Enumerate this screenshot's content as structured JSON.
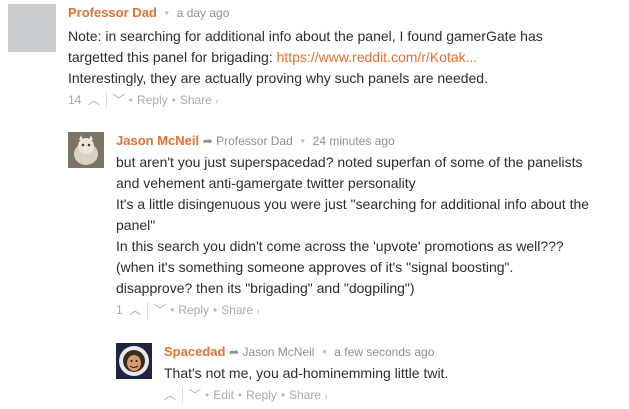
{
  "comments": [
    {
      "author": "Professor Dad",
      "reply_to": "",
      "time": "a day ago",
      "lines": [
        "Note: in searching for additional info about the panel, I found gamerGate has",
        "targetted this panel for brigading: ",
        "Interestingly, they are actually proving why such panels are needed."
      ],
      "link_text": "https://www.reddit.com/r/Kotak...",
      "upvotes": "14",
      "actions": {
        "reply": "Reply",
        "share": "Share"
      }
    },
    {
      "author": "Jason McNeil",
      "reply_to": "Professor Dad",
      "time": "24 minutes ago",
      "lines": [
        "but aren't you just superspacedad? noted superfan of some of the panelists",
        "and vehement anti-gamergate twitter personality",
        "It's a little disingenuous you were just \"searching for additional info about the",
        "panel\"",
        "In this search you didn't come across the 'upvote' promotions as well???",
        "(when it's something someone approves of it's \"signal boosting\".",
        "disapprove? then its \"brigading\" and \"dogpiling\")"
      ],
      "upvotes": "1",
      "actions": {
        "reply": "Reply",
        "share": "Share"
      }
    },
    {
      "author": "Spacedad",
      "reply_to": "Jason McNeil",
      "time": "a few seconds ago",
      "lines": [
        "That's not me, you ad-hominemming little twit."
      ],
      "upvotes": "",
      "actions": {
        "edit": "Edit",
        "reply": "Reply",
        "share": "Share"
      }
    }
  ],
  "colors": {
    "author": "#e4712f",
    "muted": "#8c9091",
    "text": "#2a2e2e"
  },
  "icons": {
    "upvote": "chevron-up-icon",
    "downvote": "chevron-down-icon",
    "reply_arrow": "reply-arrow-icon",
    "share": "chevron-right-icon"
  }
}
